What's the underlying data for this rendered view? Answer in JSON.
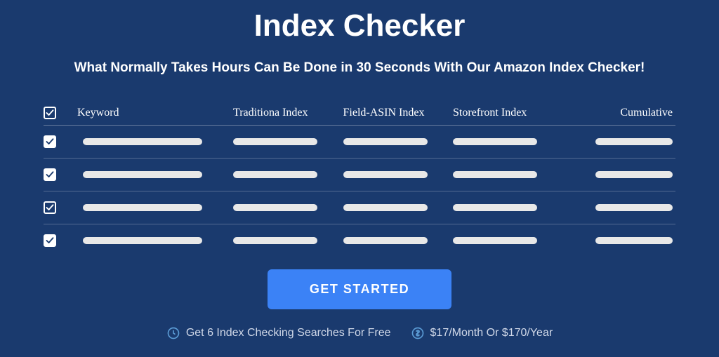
{
  "header": {
    "title": "Index Checker",
    "subtitle": "What Normally Takes Hours Can Be Done in 30 Seconds With Our Amazon Index Checker!"
  },
  "table": {
    "columns": {
      "keyword": "Keyword",
      "traditional": "Traditiona Index",
      "fieldAsin": "Field-ASIN Index",
      "storefront": "Storefront Index",
      "cumulative": "Cumulative"
    },
    "rows": [
      {
        "checked": true,
        "checkStyle": "filled"
      },
      {
        "checked": true,
        "checkStyle": "filled"
      },
      {
        "checked": true,
        "checkStyle": "outline"
      },
      {
        "checked": true,
        "checkStyle": "filled"
      }
    ]
  },
  "cta": {
    "label": "GET STARTED"
  },
  "footer": {
    "freeText": "Get 6 Index Checking Searches For Free",
    "pricingText": "$17/Month Or $170/Year"
  }
}
